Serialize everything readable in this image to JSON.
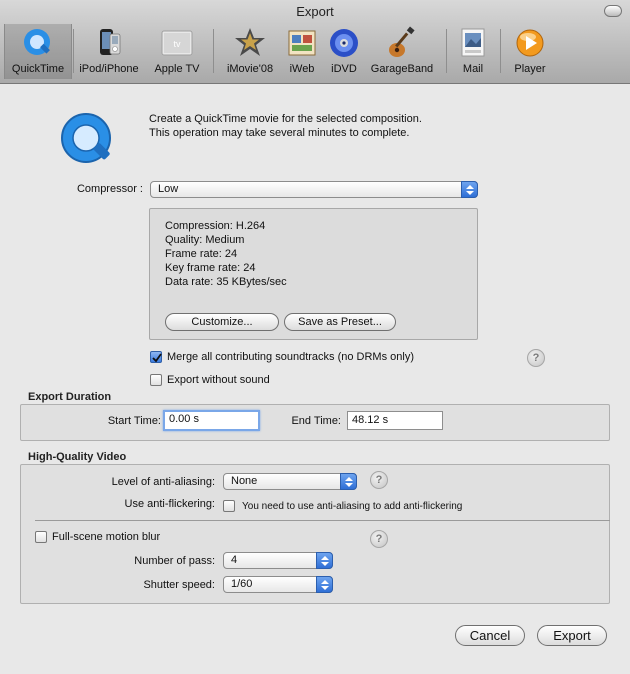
{
  "window": {
    "title": "Export"
  },
  "toolbar": {
    "items": [
      {
        "label": "QuickTime",
        "icon": "quicktime-icon",
        "selected": true
      },
      {
        "label": "iPod/iPhone",
        "icon": "ipod-iphone-icon"
      },
      {
        "label": "Apple TV",
        "icon": "apple-tv-icon",
        "badge": "tv"
      },
      {
        "label": "iMovie'08",
        "icon": "imovie-icon"
      },
      {
        "label": "iWeb",
        "icon": "iweb-icon"
      },
      {
        "label": "iDVD",
        "icon": "idvd-icon"
      },
      {
        "label": "GarageBand",
        "icon": "garageband-icon"
      },
      {
        "label": "Mail",
        "icon": "mail-icon"
      },
      {
        "label": "Player",
        "icon": "player-icon"
      }
    ]
  },
  "quicktime": {
    "icon": "quicktime-logo-icon",
    "description_line1": "Create a QuickTime movie for the selected composition.",
    "description_line2": "This operation may take several minutes to complete.",
    "compressor_label": "Compressor :",
    "compressor_value": "Low",
    "info": {
      "compression": "Compression: H.264",
      "quality": "Quality: Medium",
      "frame_rate": "Frame rate: 24",
      "key_frame_rate": "Key frame rate: 24",
      "data_rate": "Data rate: 35 KBytes/sec"
    },
    "customize_label": "Customize...",
    "save_preset_label": "Save as Preset...",
    "merge_soundtracks_label": "Merge all contributing soundtracks (no DRMs only)",
    "merge_soundtracks_checked": true,
    "export_without_sound_label": "Export without sound",
    "export_without_sound_checked": false,
    "help_glyph": "?"
  },
  "export_duration": {
    "title": "Export Duration",
    "start_label": "Start Time:",
    "start_value": "0.00 s",
    "end_label": "End Time:",
    "end_value": "48.12 s"
  },
  "hq_video": {
    "title": "High-Quality Video",
    "antialiasing_label": "Level of anti-aliasing:",
    "antialiasing_value": "None",
    "antiflicker_label": "Use anti-flickering:",
    "antiflicker_note": "You need to use anti-aliasing to add anti-flickering",
    "antiflicker_checked": false,
    "motion_blur_label": "Full-scene motion blur",
    "motion_blur_checked": false,
    "passes_label": "Number of pass:",
    "passes_value": "4",
    "shutter_label": "Shutter speed:",
    "shutter_value": "1/60"
  },
  "footer": {
    "cancel_label": "Cancel",
    "export_label": "Export"
  },
  "colors": {
    "accent": "#3b7ce0",
    "quicktime_blue": "#2a8fe6",
    "background": "#e8e8e8"
  }
}
